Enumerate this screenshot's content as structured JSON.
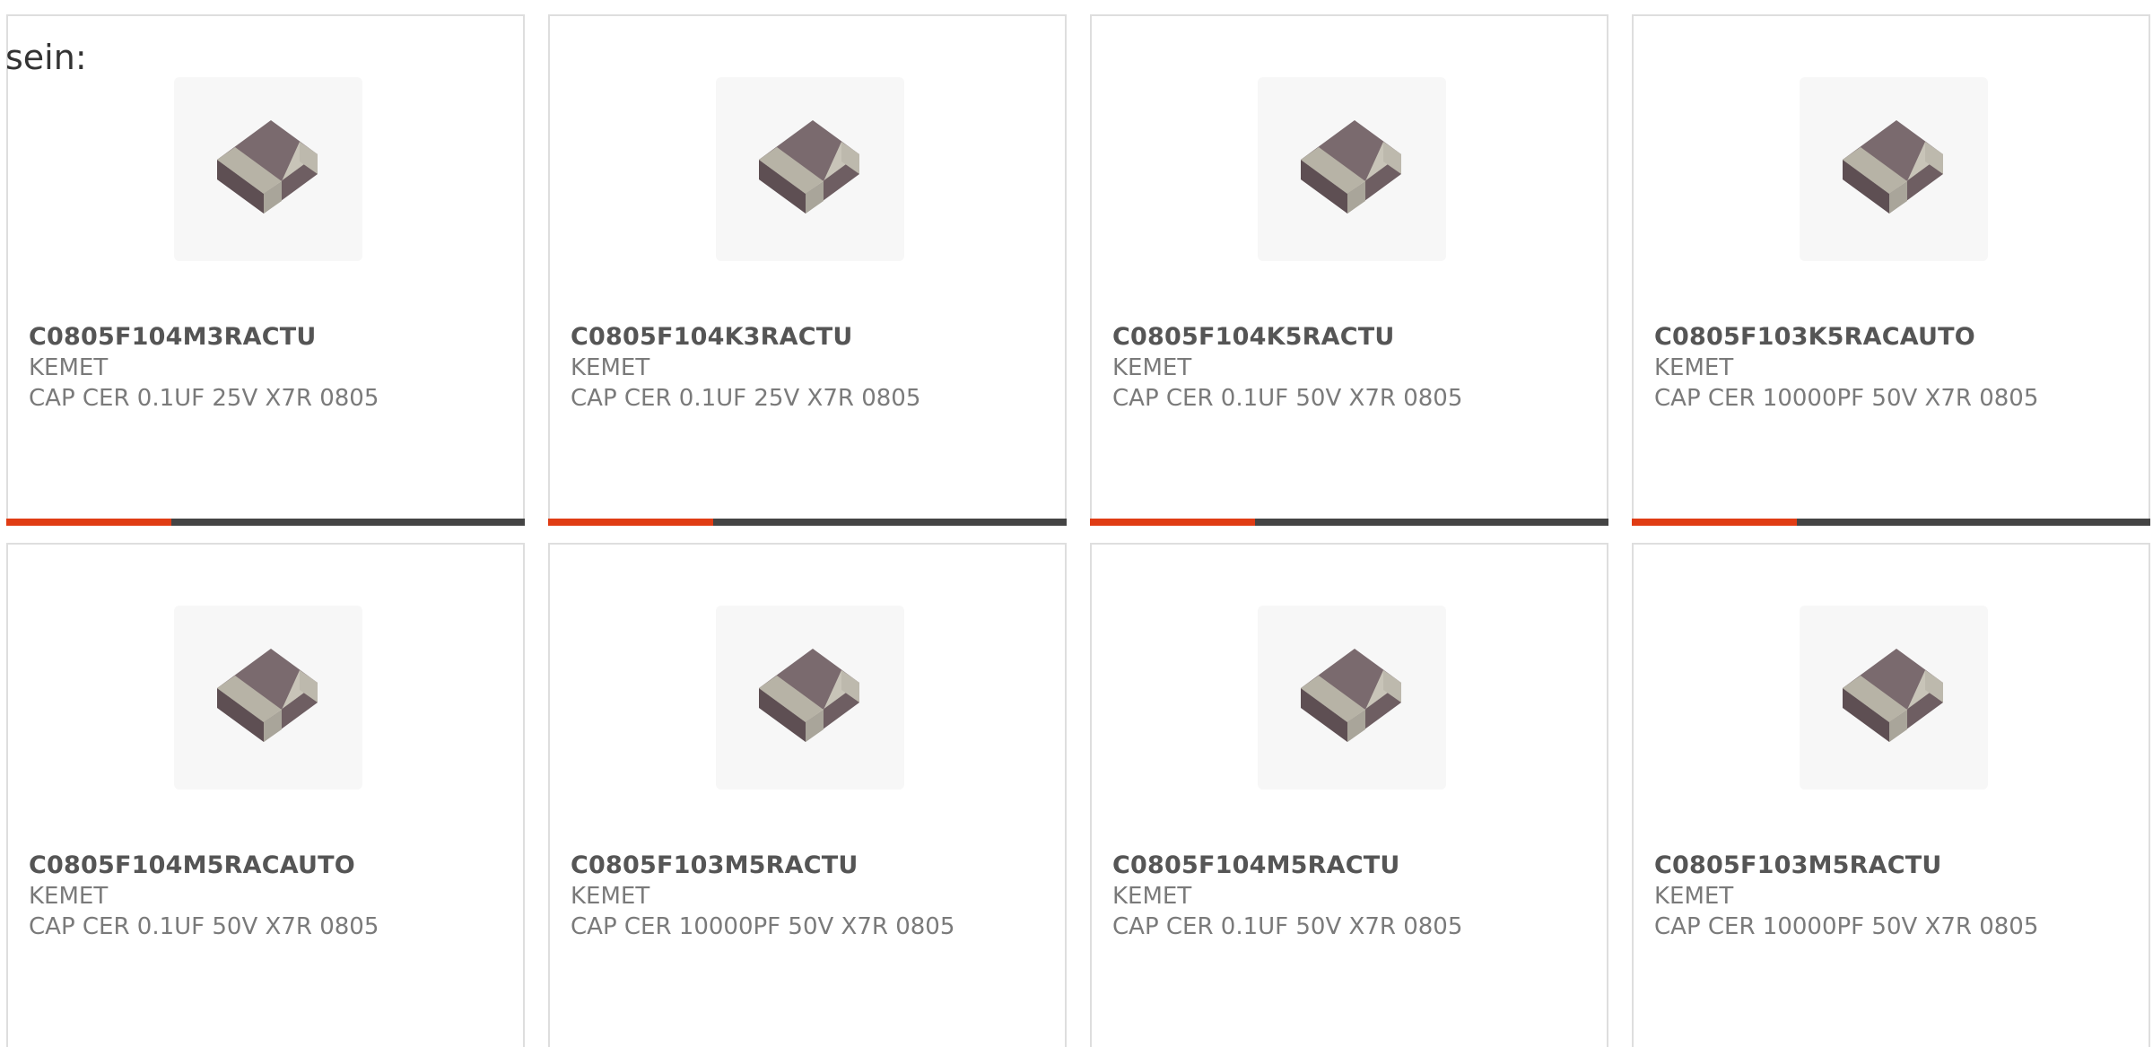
{
  "intro_text": "sein:",
  "colors": {
    "accent": "#e03c14",
    "bar": "#444444",
    "border": "#dedede"
  },
  "products": [
    {
      "part_number": "C0805F104M3RACTU",
      "manufacturer": "KEMET",
      "description": "CAP CER 0.1UF 25V X7R 0805"
    },
    {
      "part_number": "C0805F104K3RACTU",
      "manufacturer": "KEMET",
      "description": "CAP CER 0.1UF 25V X7R 0805"
    },
    {
      "part_number": "C0805F104K5RACTU",
      "manufacturer": "KEMET",
      "description": "CAP CER 0.1UF 50V X7R 0805"
    },
    {
      "part_number": "C0805F103K5RACAUTO",
      "manufacturer": "KEMET",
      "description": "CAP CER 10000PF 50V X7R 0805"
    },
    {
      "part_number": "C0805F104M5RACAUTO",
      "manufacturer": "KEMET",
      "description": "CAP CER 0.1UF 50V X7R 0805"
    },
    {
      "part_number": "C0805F103M5RACTU",
      "manufacturer": "KEMET",
      "description": "CAP CER 10000PF 50V X7R 0805"
    },
    {
      "part_number": "C0805F104M5RACTU",
      "manufacturer": "KEMET",
      "description": "CAP CER 0.1UF 50V X7R 0805"
    },
    {
      "part_number": "C0805F103M5RACTU",
      "manufacturer": "KEMET",
      "description": "CAP CER 10000PF 50V X7R 0805"
    }
  ]
}
